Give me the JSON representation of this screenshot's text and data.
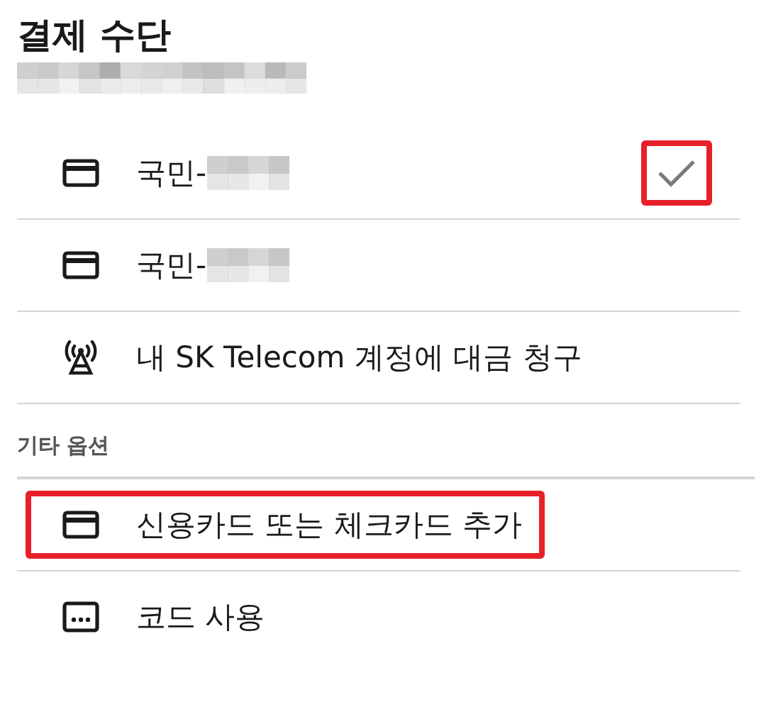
{
  "title": "결제 수단",
  "subtitle": {
    "redacted": true
  },
  "methods": [
    {
      "kind": "card",
      "label": "국민-",
      "redacted": true,
      "selected": true,
      "check_highlighted": true,
      "row_highlighted": false
    },
    {
      "kind": "card",
      "label": "국민-",
      "redacted": true,
      "selected": false,
      "check_highlighted": false,
      "row_highlighted": false
    },
    {
      "kind": "carrier",
      "label": "내 SK Telecom 계정에 대금 청구",
      "redacted": false,
      "selected": false,
      "check_highlighted": false,
      "row_highlighted": false
    }
  ],
  "other_section": {
    "heading": "기타 옵션",
    "items": [
      {
        "kind": "card",
        "label": "신용카드 또는 체크카드 추가",
        "row_highlighted": true
      },
      {
        "kind": "code",
        "label": "코드 사용",
        "row_highlighted": false
      }
    ]
  }
}
